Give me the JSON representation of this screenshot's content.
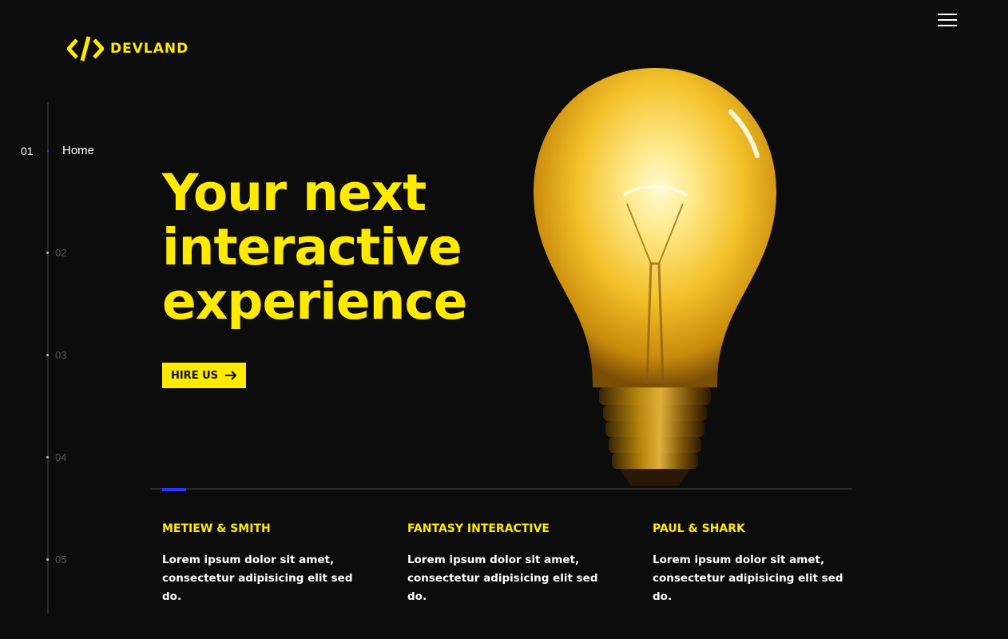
{
  "brand": {
    "name": "DEVLAND",
    "logo_icon": "code-brackets-icon",
    "accent_color": "#ffea00"
  },
  "header": {
    "menu_icon": "hamburger-menu-icon"
  },
  "side_nav": {
    "active": {
      "number": "01",
      "label": "Home"
    },
    "items": [
      {
        "number": "02"
      },
      {
        "number": "03"
      },
      {
        "number": "04"
      },
      {
        "number": "05"
      }
    ],
    "active_color": "#2b35ff"
  },
  "hero": {
    "title": "Your next\ninteractive\nexperience",
    "cta_label": "HIRE US",
    "cta_icon": "arrow-right-icon",
    "image": "light-bulb-image"
  },
  "clients": [
    {
      "name": "METIEW & SMITH",
      "description": "Lorem ipsum dolor sit amet, consectetur adipisicing elit sed do."
    },
    {
      "name": "FANTASY INTERACTIVE",
      "description": "Lorem ipsum dolor sit amet, consectetur adipisicing elit sed do."
    },
    {
      "name": "PAUL & SHARK",
      "description": "Lorem ipsum dolor sit amet, consectetur adipisicing elit sed do."
    }
  ]
}
